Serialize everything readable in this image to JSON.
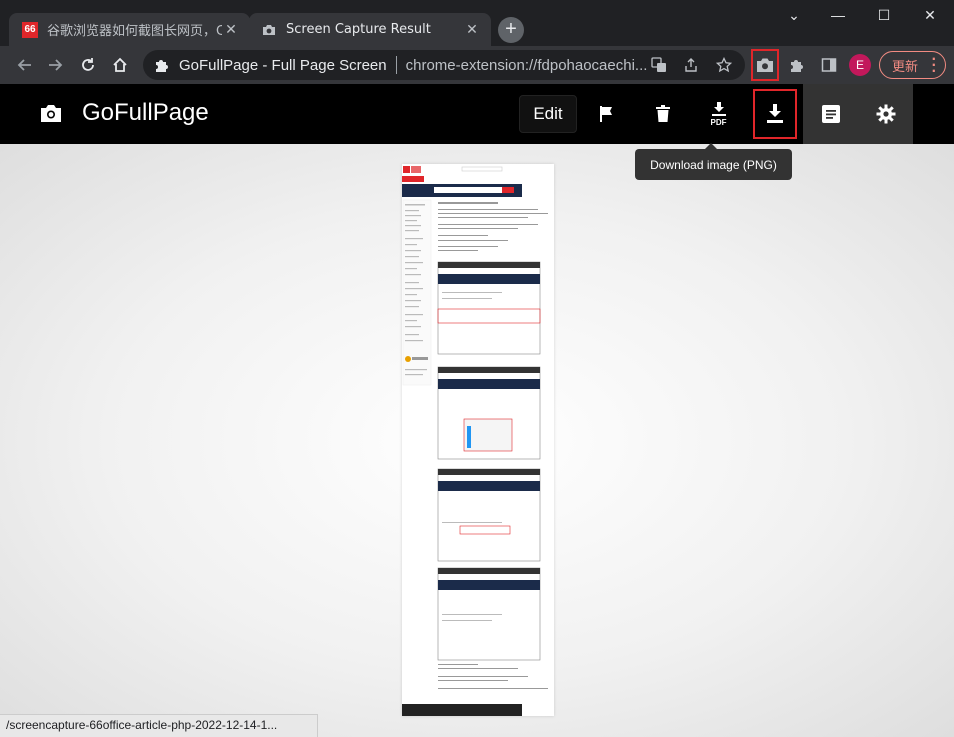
{
  "browser": {
    "tabs": [
      {
        "favicon": "66",
        "title": "谷歌浏览器如何截图长网页，Chr",
        "close": "✕"
      },
      {
        "title": "Screen Capture Result",
        "close": "✕"
      }
    ],
    "new_tab": "+",
    "window_controls": {
      "chevron": "⌄",
      "minimize": "—",
      "maximize": "☐",
      "close": "✕"
    },
    "omnibox": {
      "site_name": "GoFullPage - Full Page Screen",
      "url": "chrome-extension://fdpohaocaechi..."
    },
    "avatar_letter": "E",
    "update_label": "更新",
    "highlight_color": "#e0262a"
  },
  "app": {
    "title": "GoFullPage",
    "edit_label": "Edit",
    "pdf_label": "PDF",
    "tooltip": "Download image (PNG)"
  },
  "status_bar": "/screencapture-66office-article-php-2022-12-14-1..."
}
